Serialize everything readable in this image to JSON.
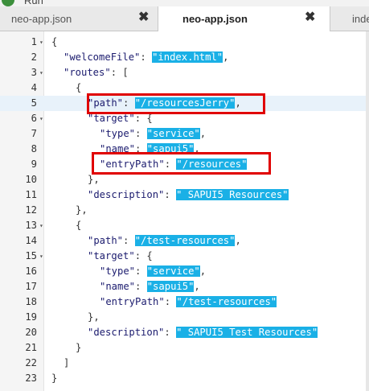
{
  "toolbar": {
    "run_label": "Run"
  },
  "tabs": [
    {
      "label": "neo-app.json"
    },
    {
      "label": "neo-app.json"
    },
    {
      "label": "inde"
    }
  ],
  "editor": {
    "lines": [
      {
        "n": "1",
        "fold": true,
        "indent": 0,
        "tokens": [
          {
            "t": "p",
            "s": "{"
          }
        ]
      },
      {
        "n": "2",
        "fold": false,
        "indent": 1,
        "tokens": [
          {
            "t": "k",
            "s": "\"welcomeFile\""
          },
          {
            "t": "p",
            "s": ": "
          },
          {
            "t": "v",
            "s": "\"index.html\""
          },
          {
            "t": "p",
            "s": ","
          }
        ]
      },
      {
        "n": "3",
        "fold": true,
        "indent": 1,
        "tokens": [
          {
            "t": "k",
            "s": "\"routes\""
          },
          {
            "t": "p",
            "s": ": ["
          }
        ]
      },
      {
        "n": "4",
        "fold": false,
        "indent": 2,
        "tokens": [
          {
            "t": "p",
            "s": "{"
          }
        ]
      },
      {
        "n": "5",
        "fold": false,
        "indent": 3,
        "active": true,
        "tokens": [
          {
            "t": "k",
            "s": "\"path\""
          },
          {
            "t": "p",
            "s": ": "
          },
          {
            "t": "v",
            "s": "\"/resourcesJerry\""
          },
          {
            "t": "p",
            "s": ","
          }
        ]
      },
      {
        "n": "6",
        "fold": true,
        "indent": 3,
        "tokens": [
          {
            "t": "k",
            "s": "\"target\""
          },
          {
            "t": "p",
            "s": ": {"
          }
        ]
      },
      {
        "n": "7",
        "fold": false,
        "indent": 4,
        "tokens": [
          {
            "t": "k",
            "s": "\"type\""
          },
          {
            "t": "p",
            "s": ": "
          },
          {
            "t": "v",
            "s": "\"service\""
          },
          {
            "t": "p",
            "s": ","
          }
        ]
      },
      {
        "n": "8",
        "fold": false,
        "indent": 4,
        "tokens": [
          {
            "t": "k",
            "s": "\"name\""
          },
          {
            "t": "p",
            "s": ": "
          },
          {
            "t": "v",
            "s": "\"sapui5\""
          },
          {
            "t": "p",
            "s": ","
          }
        ]
      },
      {
        "n": "9",
        "fold": false,
        "indent": 4,
        "tokens": [
          {
            "t": "k",
            "s": "\"entryPath\""
          },
          {
            "t": "p",
            "s": ": "
          },
          {
            "t": "v",
            "s": "\"/resources\""
          }
        ]
      },
      {
        "n": "10",
        "fold": false,
        "indent": 3,
        "tokens": [
          {
            "t": "p",
            "s": "},"
          }
        ]
      },
      {
        "n": "11",
        "fold": false,
        "indent": 3,
        "tokens": [
          {
            "t": "k",
            "s": "\"description\""
          },
          {
            "t": "p",
            "s": ": "
          },
          {
            "t": "v",
            "s": "\" SAPUI5 Resources\""
          }
        ]
      },
      {
        "n": "12",
        "fold": false,
        "indent": 2,
        "tokens": [
          {
            "t": "p",
            "s": "},"
          }
        ]
      },
      {
        "n": "13",
        "fold": true,
        "indent": 2,
        "tokens": [
          {
            "t": "p",
            "s": "{"
          }
        ]
      },
      {
        "n": "14",
        "fold": false,
        "indent": 3,
        "tokens": [
          {
            "t": "k",
            "s": "\"path\""
          },
          {
            "t": "p",
            "s": ": "
          },
          {
            "t": "v",
            "s": "\"/test-resources\""
          },
          {
            "t": "p",
            "s": ","
          }
        ]
      },
      {
        "n": "15",
        "fold": true,
        "indent": 3,
        "tokens": [
          {
            "t": "k",
            "s": "\"target\""
          },
          {
            "t": "p",
            "s": ": {"
          }
        ]
      },
      {
        "n": "16",
        "fold": false,
        "indent": 4,
        "tokens": [
          {
            "t": "k",
            "s": "\"type\""
          },
          {
            "t": "p",
            "s": ": "
          },
          {
            "t": "v",
            "s": "\"service\""
          },
          {
            "t": "p",
            "s": ","
          }
        ]
      },
      {
        "n": "17",
        "fold": false,
        "indent": 4,
        "tokens": [
          {
            "t": "k",
            "s": "\"name\""
          },
          {
            "t": "p",
            "s": ": "
          },
          {
            "t": "v",
            "s": "\"sapui5\""
          },
          {
            "t": "p",
            "s": ","
          }
        ]
      },
      {
        "n": "18",
        "fold": false,
        "indent": 4,
        "tokens": [
          {
            "t": "k",
            "s": "\"entryPath\""
          },
          {
            "t": "p",
            "s": ": "
          },
          {
            "t": "v",
            "s": "\"/test-resources\""
          }
        ]
      },
      {
        "n": "19",
        "fold": false,
        "indent": 3,
        "tokens": [
          {
            "t": "p",
            "s": "},"
          }
        ]
      },
      {
        "n": "20",
        "fold": false,
        "indent": 3,
        "tokens": [
          {
            "t": "k",
            "s": "\"description\""
          },
          {
            "t": "p",
            "s": ": "
          },
          {
            "t": "v",
            "s": "\" SAPUI5 Test Resources\""
          }
        ]
      },
      {
        "n": "21",
        "fold": false,
        "indent": 2,
        "tokens": [
          {
            "t": "p",
            "s": "}"
          }
        ]
      },
      {
        "n": "22",
        "fold": false,
        "indent": 1,
        "tokens": [
          {
            "t": "p",
            "s": "]"
          }
        ]
      },
      {
        "n": "23",
        "fold": false,
        "indent": 0,
        "tokens": [
          {
            "t": "p",
            "s": "}"
          }
        ]
      }
    ]
  },
  "colors": {
    "string_highlight": "#1ab0e6",
    "annotation_box": "#e00000",
    "active_line": "#e8f2fa"
  }
}
